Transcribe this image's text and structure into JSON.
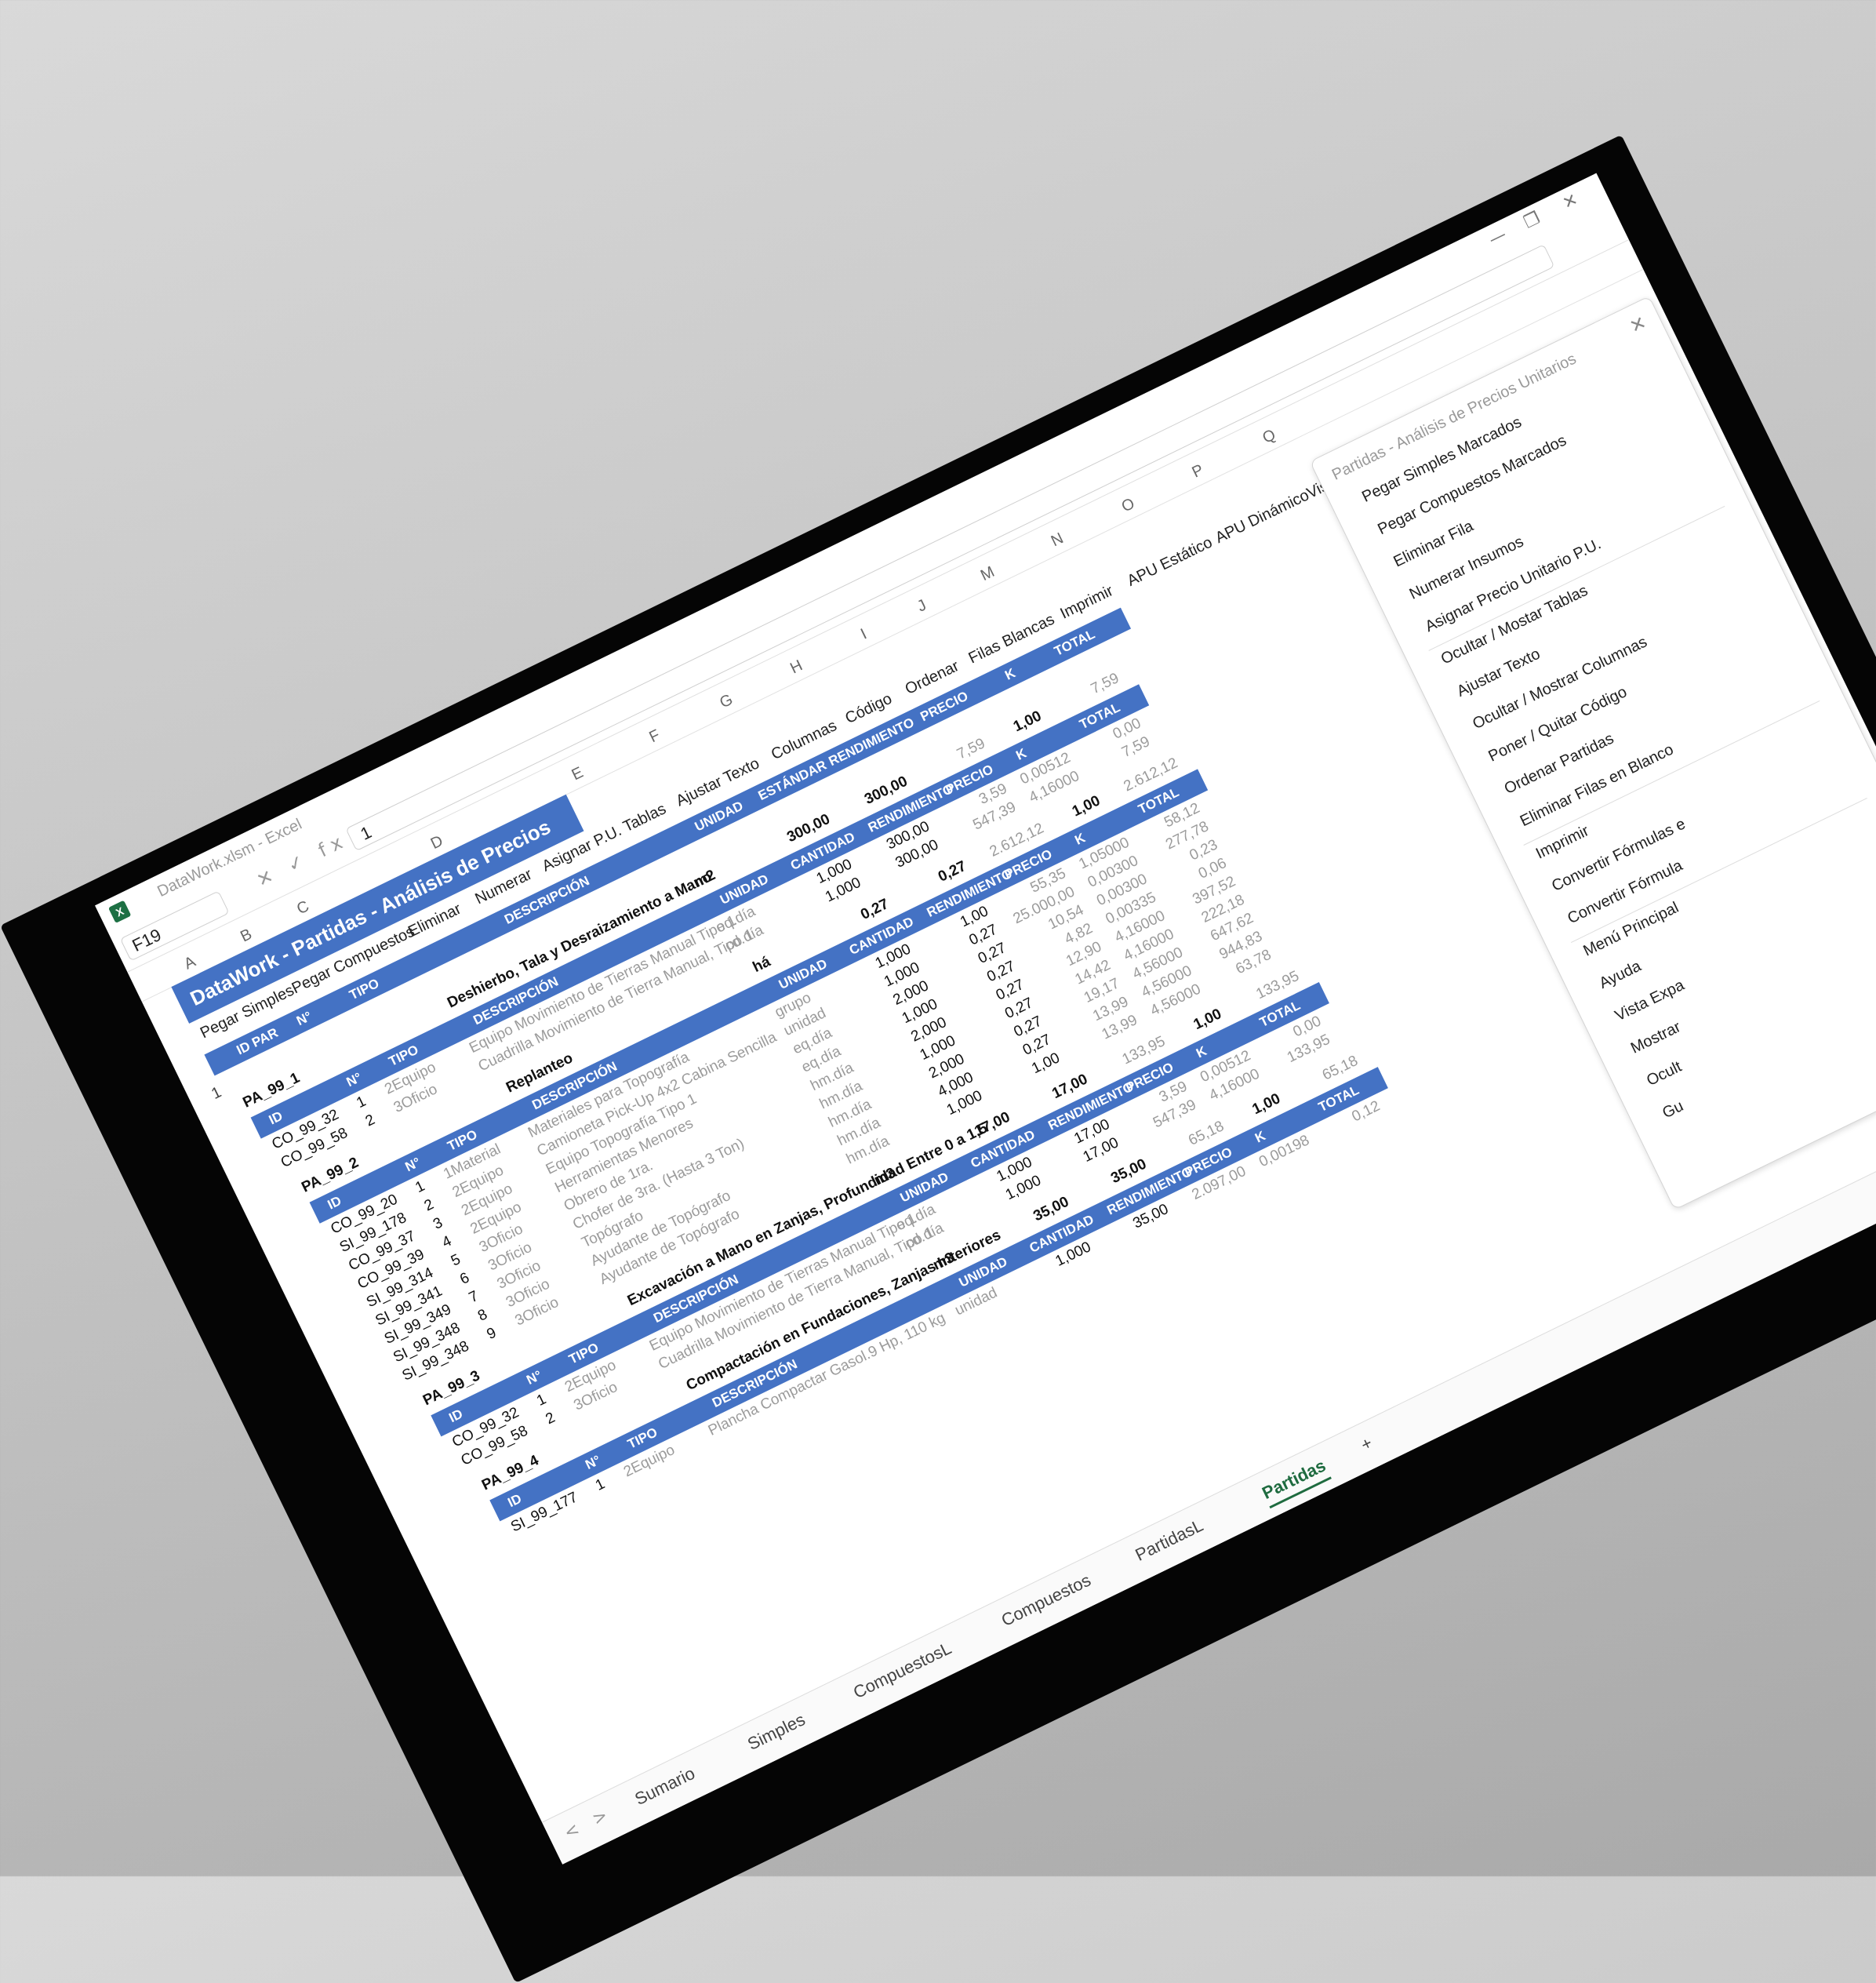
{
  "window": {
    "title": "DataWork.xlsm - Excel",
    "app_icon_letter": "X",
    "controls": [
      "—",
      "❐",
      "✕"
    ]
  },
  "formula_bar": {
    "name_box": "F19",
    "formula": "1",
    "icons": "✕ ✓ fx"
  },
  "columns": [
    "A",
    "B",
    "C",
    "D",
    "E",
    "F",
    "G",
    "H",
    "I",
    "J",
    "M",
    "N",
    "O",
    "P",
    "Q"
  ],
  "sheet": {
    "banner": "DataWork - Partidas - Análisis de Precios Unitarios",
    "menu": [
      "Pegar Simples",
      "Pegar Compuestos",
      "Eliminar",
      "Numerar",
      "Asignar P.U.",
      "Tablas",
      "Ajustar Texto",
      "Columnas",
      "Código",
      "Ordenar",
      "Filas Blancas",
      "Imprimir",
      "APU Estático",
      "APU Dinámico",
      "Vista"
    ],
    "header1": [
      "ID PAR",
      "N°",
      "TIPO",
      "DESCRIPCIÓN",
      "UNIDAD",
      "ESTÁNDAR",
      "RENDIMIENTO",
      "PRECIO",
      "K",
      "TOTAL"
    ],
    "sub_header": [
      "ID",
      "N°",
      "TIPO",
      "DESCRIPCIÓN",
      "UNIDAD",
      "CANTIDAD",
      "RENDIMIENTO",
      "PRECIO",
      "K",
      "TOTAL"
    ],
    "blocks": [
      {
        "id": "PA_99_1",
        "title": "Deshierbo, Tala y Desraizamiento a Mano",
        "unit": "m2",
        "standard": "300,00",
        "rendimiento": "300,00",
        "precio": "7,59",
        "k": "1,00",
        "total": "7,59",
        "rows": [
          {
            "id": "CO_99_32",
            "n": "1",
            "tipo": "2Equipo",
            "desc": "Equipo Movimiento de Tierras Manual Tipo 1",
            "unidad": "eq.día",
            "cantidad": "1,000",
            "rend": "300,00",
            "precio": "3,59",
            "k": "0,00512",
            "total": "0,00"
          },
          {
            "id": "CO_99_58",
            "n": "2",
            "tipo": "3Oficio",
            "desc": "Cuadrilla Movimiento de Tierra Manual, Tipo 1",
            "unidad": "cd.día",
            "cantidad": "1,000",
            "rend": "300,00",
            "precio": "547,39",
            "k": "4,16000",
            "total": "7,59"
          }
        ]
      },
      {
        "id": "PA_99_2",
        "title": "Replanteo",
        "unit": "há",
        "standard": "0,27",
        "rendimiento": "0,27",
        "precio": "2.612,12",
        "k": "1,00",
        "total": "2.612,12",
        "rows": [
          {
            "id": "CO_99_20",
            "n": "1",
            "tipo": "1Material",
            "desc": "Materiales para Topografía",
            "unidad": "grupo",
            "cantidad": "1,000",
            "rend": "1,00",
            "precio": "55,35",
            "k": "1,05000",
            "total": "58,12"
          },
          {
            "id": "SI_99_178",
            "n": "2",
            "tipo": "2Equipo",
            "desc": "Camioneta Pick-Up 4x2 Cabina Sencilla",
            "unidad": "unidad",
            "cantidad": "1,000",
            "rend": "0,27",
            "precio": "25.000,00",
            "k": "0,00300",
            "total": "277,78"
          },
          {
            "id": "CO_99_37",
            "n": "3",
            "tipo": "2Equipo",
            "desc": "Equipo Topografía Tipo 1",
            "unidad": "eq.día",
            "cantidad": "2,000",
            "rend": "0,27",
            "precio": "10,54",
            "k": "0,00300",
            "total": "0,23"
          },
          {
            "id": "CO_99_39",
            "n": "4",
            "tipo": "2Equipo",
            "desc": "Herramientas Menores",
            "unidad": "eq.día",
            "cantidad": "1,000",
            "rend": "0,27",
            "precio": "4,82",
            "k": "0,00335",
            "total": "0,06"
          },
          {
            "id": "SI_99_314",
            "n": "5",
            "tipo": "3Oficio",
            "desc": "Obrero de 1ra.",
            "unidad": "hm.día",
            "cantidad": "2,000",
            "rend": "0,27",
            "precio": "12,90",
            "k": "4,16000",
            "total": "397,52"
          },
          {
            "id": "SI_99_341",
            "n": "6",
            "tipo": "3Oficio",
            "desc": "Chofer de 3ra. (Hasta 3 Ton)",
            "unidad": "hm.día",
            "cantidad": "1,000",
            "rend": "0,27",
            "precio": "14,42",
            "k": "4,16000",
            "total": "222,18"
          },
          {
            "id": "SI_99_349",
            "n": "7",
            "tipo": "3Oficio",
            "desc": "Topógrafo",
            "unidad": "hm.día",
            "cantidad": "2,000",
            "rend": "0,27",
            "precio": "19,17",
            "k": "4,56000",
            "total": "647,62"
          },
          {
            "id": "SI_99_348",
            "n": "8",
            "tipo": "3Oficio",
            "desc": "Ayudante de Topógrafo",
            "unidad": "hm.día",
            "cantidad": "4,000",
            "rend": "0,27",
            "precio": "13,99",
            "k": "4,56000",
            "total": "944,83"
          },
          {
            "id": "SI_99_348",
            "n": "9",
            "tipo": "3Oficio",
            "desc": "Ayudante de Topógrafo",
            "unidad": "hm.día",
            "cantidad": "1,000",
            "rend": "1,00",
            "precio": "13,99",
            "k": "4,56000",
            "total": "63,78"
          }
        ]
      },
      {
        "id": "PA_99_3",
        "title": "Excavación a Mano en Zanjas, Profundidad Entre 0 a 1,5",
        "unit": "m3",
        "standard": "17,00",
        "rendimiento": "17,00",
        "precio": "133,95",
        "k": "1,00",
        "total": "133,95",
        "rows": [
          {
            "id": "CO_99_32",
            "n": "1",
            "tipo": "2Equipo",
            "desc": "Equipo Movimiento de Tierras Manual Tipo 1",
            "unidad": "eq.día",
            "cantidad": "1,000",
            "rend": "17,00",
            "precio": "3,59",
            "k": "0,00512",
            "total": "0,00"
          },
          {
            "id": "CO_99_58",
            "n": "2",
            "tipo": "3Oficio",
            "desc": "Cuadrilla Movimiento de Tierra Manual, Tipo 1",
            "unidad": "cd.día",
            "cantidad": "1,000",
            "rend": "17,00",
            "precio": "547,39",
            "k": "4,16000",
            "total": "133,95"
          }
        ]
      },
      {
        "id": "PA_99_4",
        "title": "Compactación en Fundaciones, Zanjas Interiores",
        "unit": "m3",
        "standard": "35,00",
        "rendimiento": "35,00",
        "precio": "65,18",
        "k": "1,00",
        "total": "65,18",
        "rows": [
          {
            "id": "SI_99_177",
            "n": "1",
            "tipo": "2Equipo",
            "desc": "Plancha Compactar Gasol.9 Hp, 110 kg",
            "unidad": "unidad",
            "cantidad": "1,000",
            "rend": "35,00",
            "precio": "2.097,00",
            "k": "0,00198",
            "total": "0,12"
          }
        ]
      }
    ]
  },
  "side_panel": {
    "title": "Partidas - Análisis de Precios Unitarios",
    "items": [
      "Pegar Simples Marcados",
      "Pegar Compuestos Marcados",
      "Eliminar Fila",
      "Numerar Insumos",
      "Asignar Precio Unitario P.U.",
      "Ocultar / Mostar Tablas",
      "Ajustar Texto",
      "Ocultar / Mostrar Columnas",
      "Poner / Quitar Código",
      "Ordenar Partidas",
      "Eliminar Filas en Blanco",
      "Imprimir",
      "Convertir Fórmulas e",
      "Convertir Fórmula",
      "Menú Principal",
      "Ayuda",
      "Vista Expa",
      "Mostrar",
      "Ocult",
      "Gu"
    ]
  },
  "tabs": [
    "Sumario",
    "Simples",
    "CompuestosL",
    "Compuestos",
    "PartidasL",
    "Partidas"
  ],
  "active_tab": "Partidas",
  "add_sheet": "+",
  "tab_nav": [
    "<",
    ">"
  ]
}
